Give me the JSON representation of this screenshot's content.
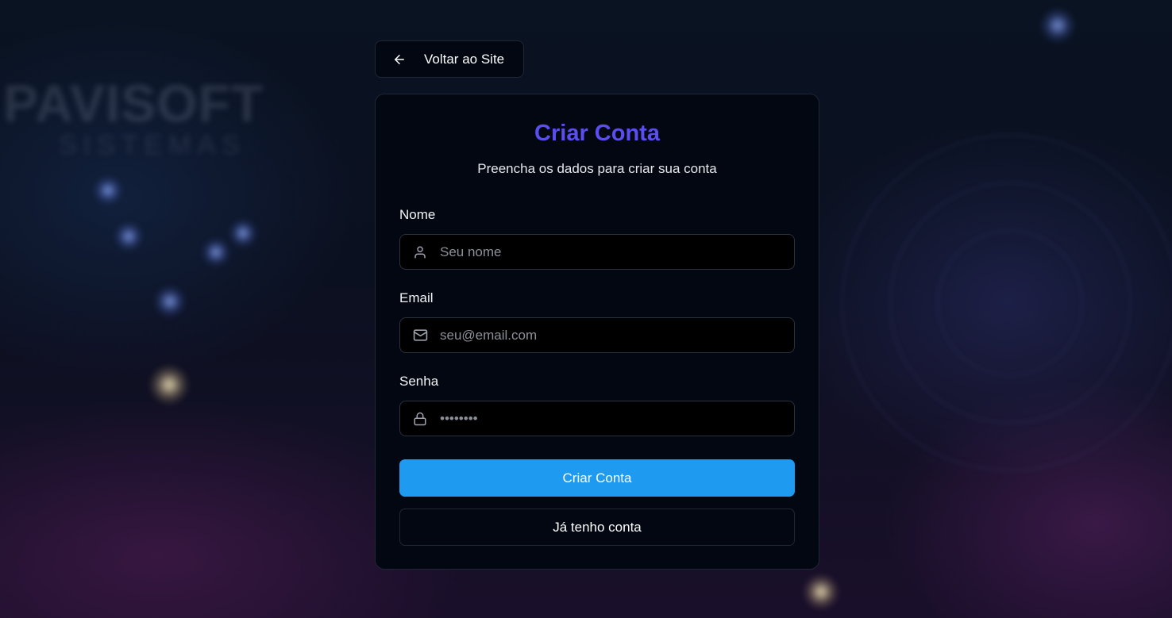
{
  "background": {
    "logo_text": "PAVISOFT",
    "logo_subtext": "SISTEMAS"
  },
  "back_button": {
    "label": "Voltar ao Site",
    "icon": "arrow-left-icon"
  },
  "form": {
    "title": "Criar Conta",
    "subtitle": "Preencha os dados para criar sua conta",
    "fields": [
      {
        "label": "Nome",
        "placeholder": "Seu nome",
        "icon": "user-icon",
        "type": "text"
      },
      {
        "label": "Email",
        "placeholder": "seu@email.com",
        "icon": "mail-icon",
        "type": "email"
      },
      {
        "label": "Senha",
        "placeholder": "••••••••",
        "icon": "lock-icon",
        "type": "password"
      }
    ],
    "submit_label": "Criar Conta",
    "login_label": "Já tenho conta"
  },
  "colors": {
    "title": "#5b4ef0",
    "primary_button": "#1e9bf0",
    "card_background": "#030712"
  }
}
